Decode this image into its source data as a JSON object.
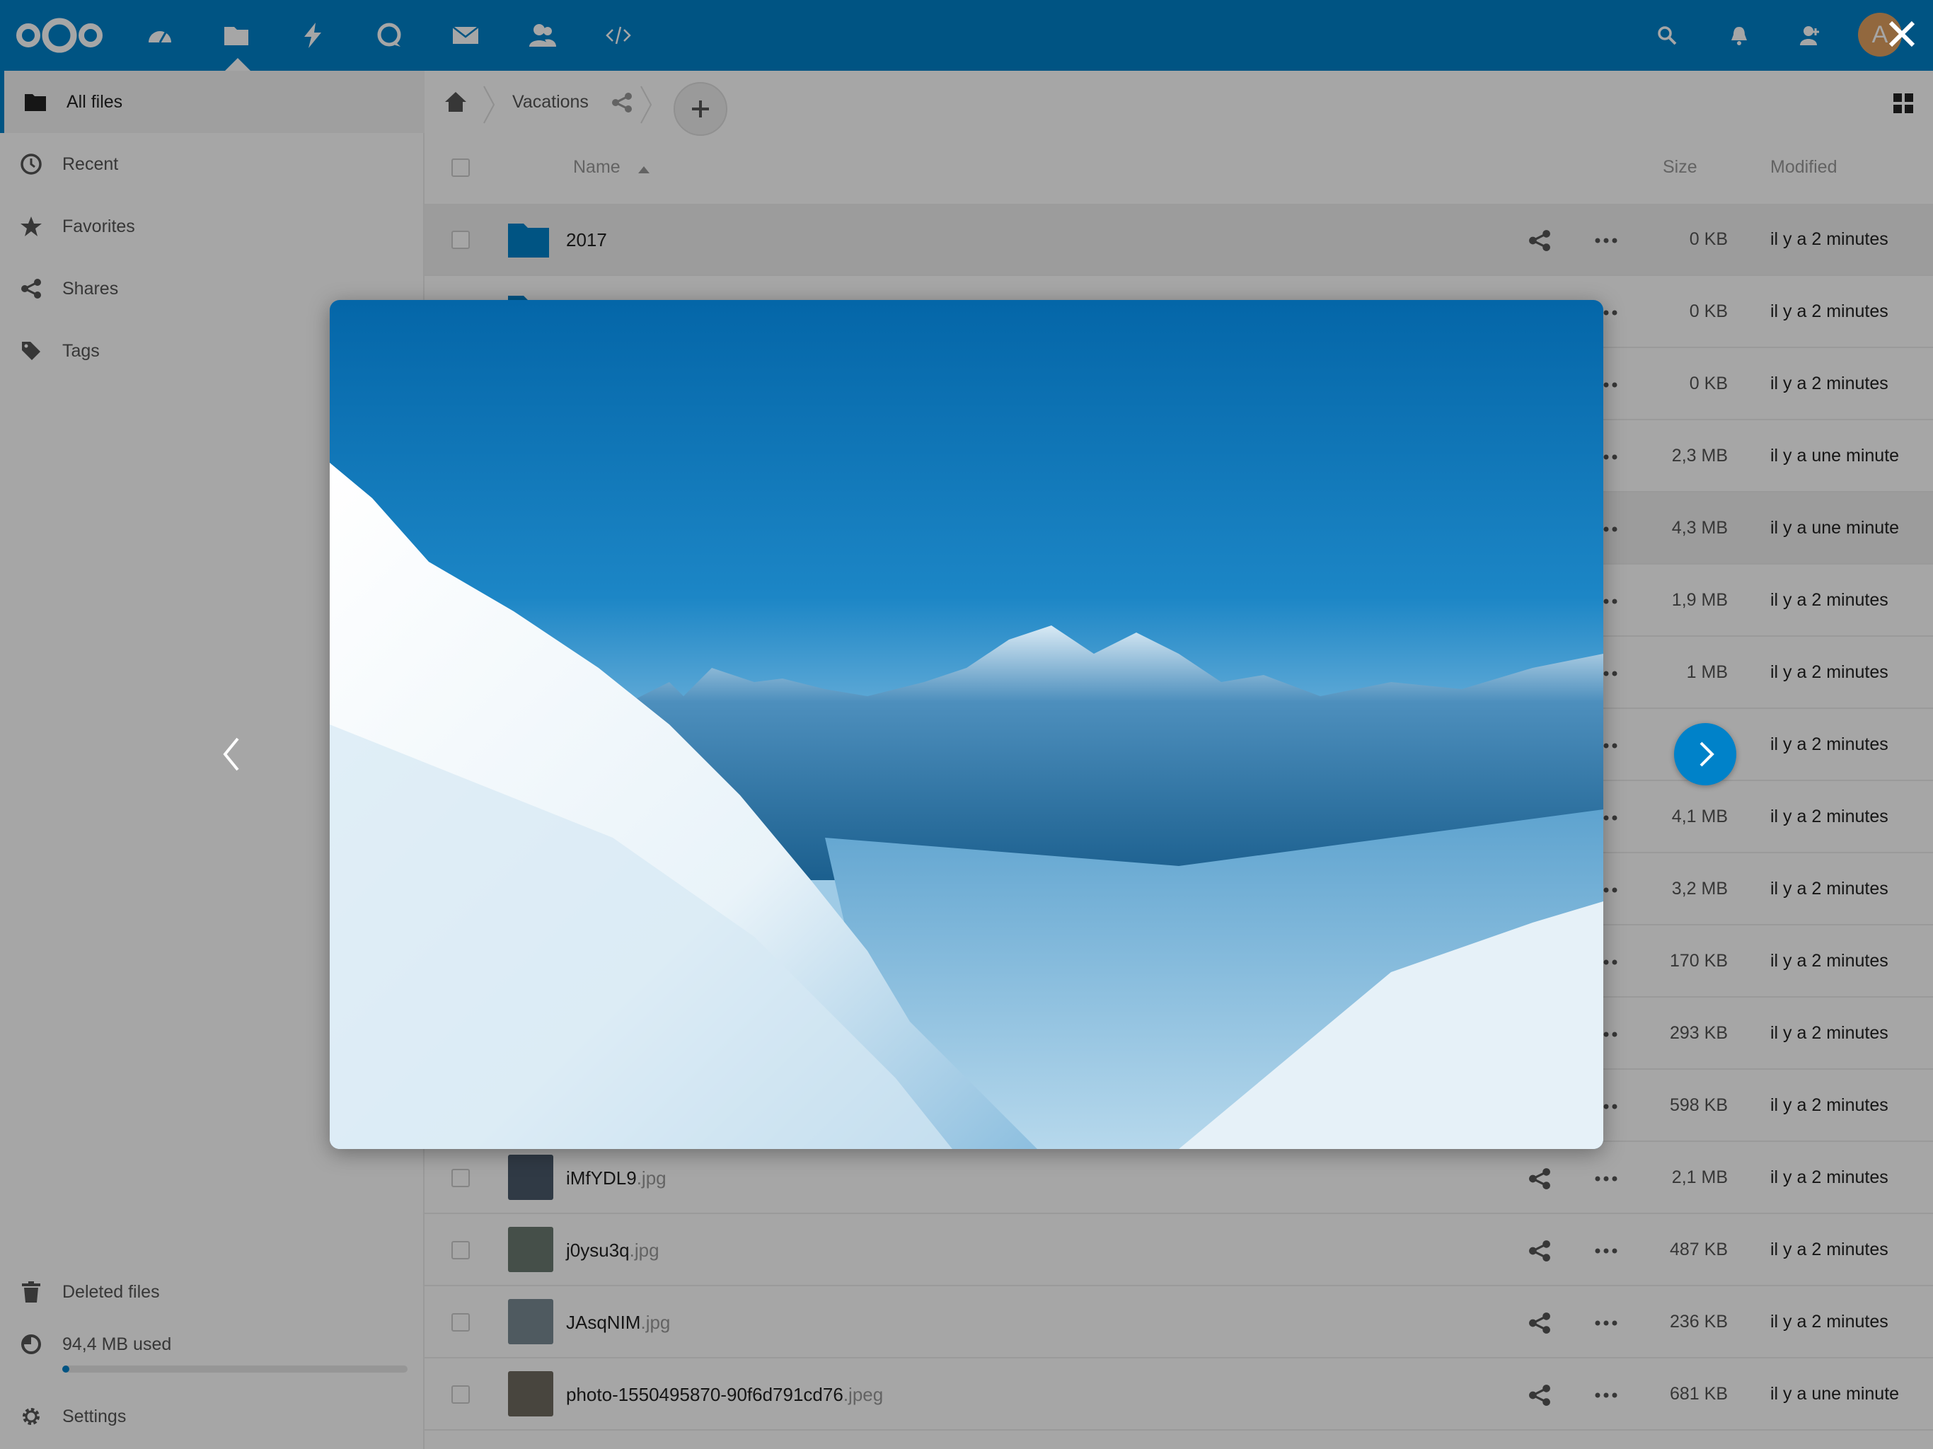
{
  "header": {
    "logo": "nextcloud-logo",
    "apps": [
      {
        "name": "dashboard-icon"
      },
      {
        "name": "files-icon"
      },
      {
        "name": "activity-icon"
      },
      {
        "name": "talk-icon"
      },
      {
        "name": "mail-icon"
      },
      {
        "name": "contacts-icon"
      },
      {
        "name": "code-icon"
      }
    ],
    "avatar_initial": "A",
    "accent_color": "#0082c9"
  },
  "sidebar": {
    "items": [
      {
        "label": "All files",
        "icon": "folder-icon",
        "active": true
      },
      {
        "label": "Recent",
        "icon": "clock-icon"
      },
      {
        "label": "Favorites",
        "icon": "star-icon"
      },
      {
        "label": "Shares",
        "icon": "share-icon"
      },
      {
        "label": "Tags",
        "icon": "tag-icon"
      }
    ],
    "deleted_label": "Deleted files",
    "quota_label": "94,4 MB used",
    "quota_fraction": 0.02,
    "settings_label": "Settings"
  },
  "breadcrumb": {
    "folder": "Vacations"
  },
  "table": {
    "headers": {
      "name": "Name",
      "size": "Size",
      "modified": "Modified"
    },
    "rows": [
      {
        "name": "2017",
        "ext": "",
        "type": "folder",
        "size": "0 KB",
        "modified": "il y a 2 minutes"
      },
      {
        "name": "",
        "ext": "",
        "type": "folder",
        "size": "0 KB",
        "modified": "il y a 2 minutes"
      },
      {
        "name": "",
        "ext": "",
        "type": "file",
        "size": "0 KB",
        "modified": "il y a 2 minutes"
      },
      {
        "name": "",
        "ext": "",
        "type": "file",
        "size": "2,3 MB",
        "modified": "il y a une minute"
      },
      {
        "name": "",
        "ext": "",
        "type": "file",
        "size": "4,3 MB",
        "modified": "il y a une minute"
      },
      {
        "name": "",
        "ext": "",
        "type": "file",
        "size": "1,9 MB",
        "modified": "il y a 2 minutes"
      },
      {
        "name": "",
        "ext": "",
        "type": "file",
        "size": "1 MB",
        "modified": "il y a 2 minutes"
      },
      {
        "name": "",
        "ext": "",
        "type": "file",
        "size": "",
        "modified": "il y a 2 minutes"
      },
      {
        "name": "",
        "ext": "",
        "type": "file",
        "size": "4,1 MB",
        "modified": "il y a 2 minutes"
      },
      {
        "name": "",
        "ext": "",
        "type": "file",
        "size": "3,2 MB",
        "modified": "il y a 2 minutes"
      },
      {
        "name": "",
        "ext": "",
        "type": "file",
        "size": "170 KB",
        "modified": "il y a 2 minutes"
      },
      {
        "name": "",
        "ext": "",
        "type": "file",
        "size": "293 KB",
        "modified": "il y a 2 minutes"
      },
      {
        "name": "",
        "ext": "",
        "type": "file",
        "size": "598 KB",
        "modified": "il y a 2 minutes"
      },
      {
        "name": "iMfYDL9",
        "ext": ".jpg",
        "type": "image",
        "size": "2,1 MB",
        "modified": "il y a 2 minutes",
        "thumb": "#4a5a6a"
      },
      {
        "name": "j0ysu3q",
        "ext": ".jpg",
        "type": "image",
        "size": "487 KB",
        "modified": "il y a 2 minutes",
        "thumb": "#6a7a70"
      },
      {
        "name": "JAsqNIM",
        "ext": ".jpg",
        "type": "image",
        "size": "236 KB",
        "modified": "il y a 2 minutes",
        "thumb": "#7a8a94"
      },
      {
        "name": "photo-1550495870-90f6d791cd76",
        "ext": ".jpeg",
        "type": "image",
        "size": "681 KB",
        "modified": "il y a une minute",
        "thumb": "#6f6a60"
      }
    ]
  },
  "viewer": {
    "image_subject": "snowy mountain landscape",
    "sky_color": "#0a7fc0",
    "snow_color": "#e8f2f8"
  }
}
